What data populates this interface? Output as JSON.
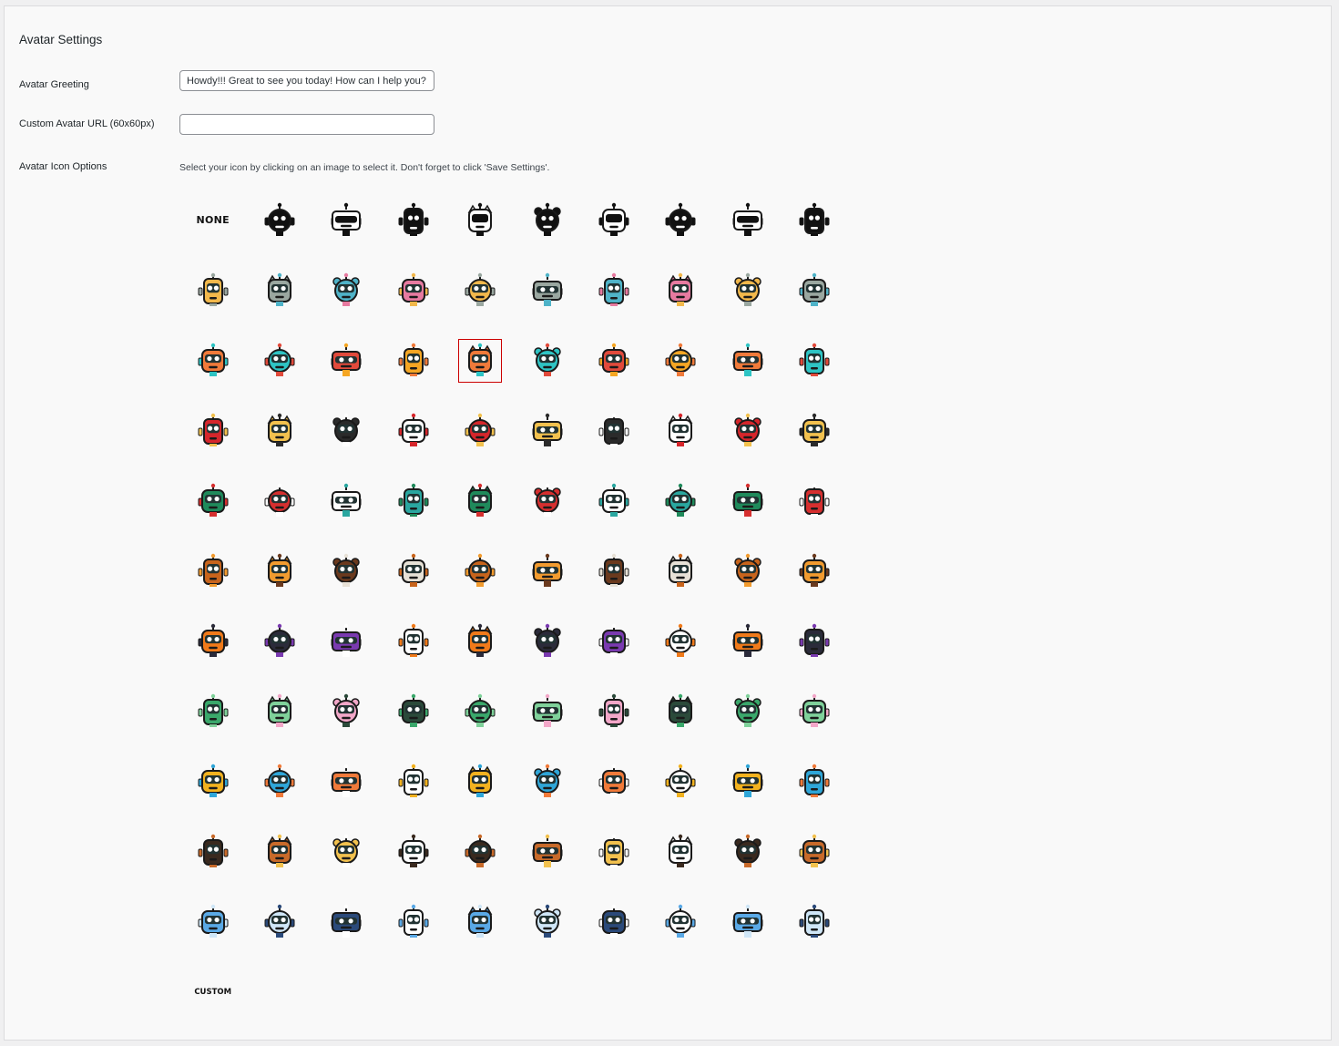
{
  "section_title": "Avatar Settings",
  "greeting": {
    "label": "Avatar Greeting",
    "value": "Howdy!!! Great to see you today! How can I help you?"
  },
  "custom_url": {
    "label": "Custom Avatar URL (60x60px)",
    "value": ""
  },
  "icon_options": {
    "label": "Avatar Icon Options",
    "help": "Select your icon by clicking on an image to select it. Don't forget to click 'Save Settings'.",
    "none_label": "NONE",
    "custom_label": "CUSTOM",
    "selected_index": 24,
    "rows": [
      {
        "theme": "monochrome robots",
        "colors": [
          "#111111",
          "#ffffff"
        ]
      },
      {
        "theme": "retro robots and pets",
        "colors": [
          "#f2b84b",
          "#9aa7a0",
          "#4fb3c8",
          "#e77aa0"
        ]
      },
      {
        "theme": "cartoon animals and bots",
        "colors": [
          "#f07a3a",
          "#2ec4c4",
          "#e14a3b",
          "#f5a623"
        ]
      },
      {
        "theme": "lunar new year",
        "colors": [
          "#d6262b",
          "#f2c14e",
          "#2b2b2b",
          "#ffffff"
        ]
      },
      {
        "theme": "christmas",
        "colors": [
          "#1f8a5b",
          "#d62f2f",
          "#ffffff",
          "#2aa7a0"
        ]
      },
      {
        "theme": "autumn",
        "colors": [
          "#c8641c",
          "#f29b2f",
          "#6b3a1e",
          "#e7e1d6"
        ]
      },
      {
        "theme": "halloween",
        "colors": [
          "#f07a1a",
          "#2b2b3a",
          "#7a3ab0",
          "#ffffff"
        ]
      },
      {
        "theme": "spring",
        "colors": [
          "#3aa86b",
          "#7fd19a",
          "#f2a7c8",
          "#2b4a3a"
        ]
      },
      {
        "theme": "summer",
        "colors": [
          "#f2b21f",
          "#2fa6d8",
          "#f07a3a",
          "#ffffff"
        ]
      },
      {
        "theme": "thanksgiving",
        "colors": [
          "#3a2a1f",
          "#c86a2a",
          "#f2c14e",
          "#ffffff"
        ]
      },
      {
        "theme": "winter",
        "colors": [
          "#5aa9e6",
          "#cfe6f7",
          "#2b4a7a",
          "#ffffff"
        ]
      }
    ]
  }
}
